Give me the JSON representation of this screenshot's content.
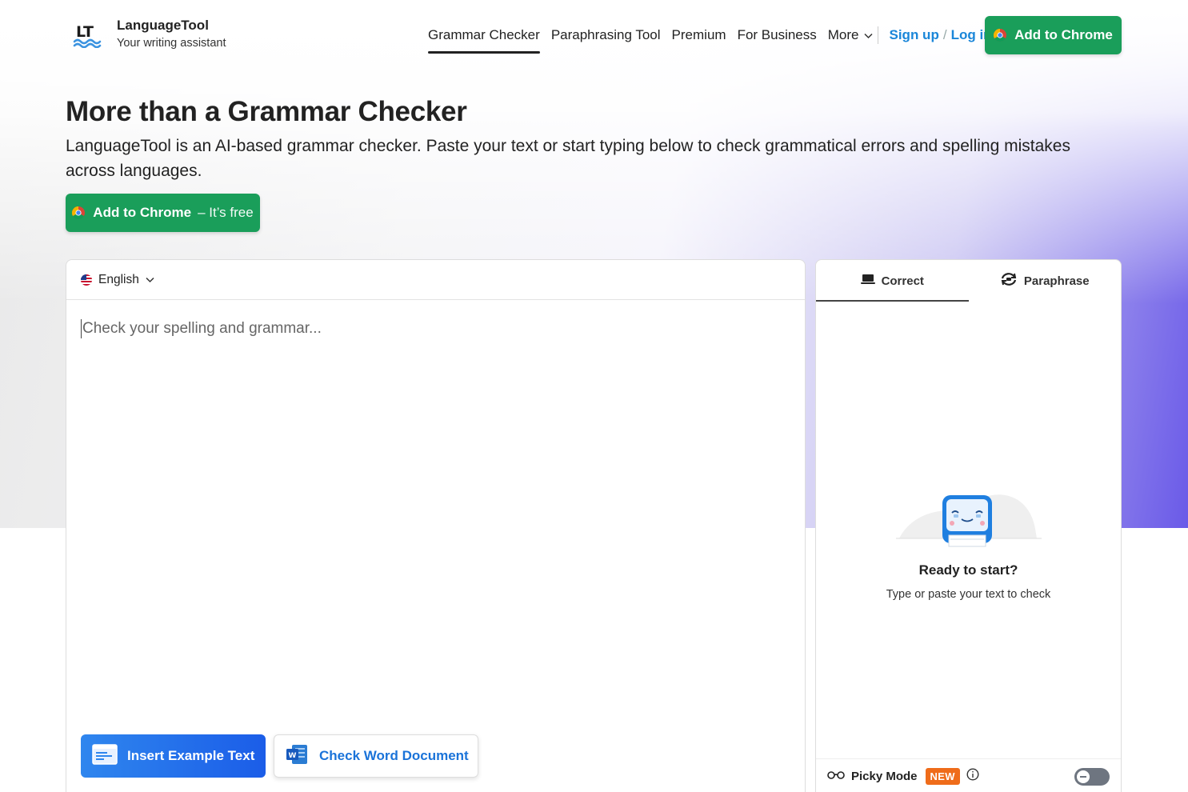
{
  "brand": {
    "name_part1": "Language",
    "name_part2": "Tool",
    "tagline": "Your writing assistant"
  },
  "nav": {
    "items": [
      {
        "label": "Grammar Checker",
        "active": true
      },
      {
        "label": "Paraphrasing Tool",
        "active": false
      },
      {
        "label": "Premium",
        "active": false
      },
      {
        "label": "For Business",
        "active": false
      },
      {
        "label": "More",
        "active": false
      }
    ],
    "sign_up": "Sign up",
    "separator": "/",
    "log_in": "Log in",
    "add_to_chrome": "Add to Chrome"
  },
  "hero": {
    "title": "More than a Grammar Checker",
    "description": "LanguageTool is an AI-based grammar checker. Paste your text or start typing below to check grammatical errors and spelling mistakes across languages.",
    "cta_main": "Add to Chrome",
    "cta_suffix": "– It’s free"
  },
  "editor": {
    "language": "English",
    "placeholder": "Check your spelling and grammar...",
    "insert_example": "Insert Example Text",
    "check_word": "Check Word Document"
  },
  "sidebar": {
    "tabs": [
      {
        "label": "Correct",
        "active": true
      },
      {
        "label": "Paraphrase",
        "active": false
      }
    ],
    "ready_title": "Ready to start?",
    "ready_subtitle": "Type or paste your text to check",
    "picky_mode": "Picky Mode",
    "new_badge": "NEW",
    "picky_enabled": false
  },
  "colors": {
    "brand_green": "#1a9e5a",
    "link_blue": "#1a86d9",
    "button_blue": "#1b5de8",
    "badge_orange": "#ef6c1a",
    "hero_purple": "#6a5ae8"
  }
}
